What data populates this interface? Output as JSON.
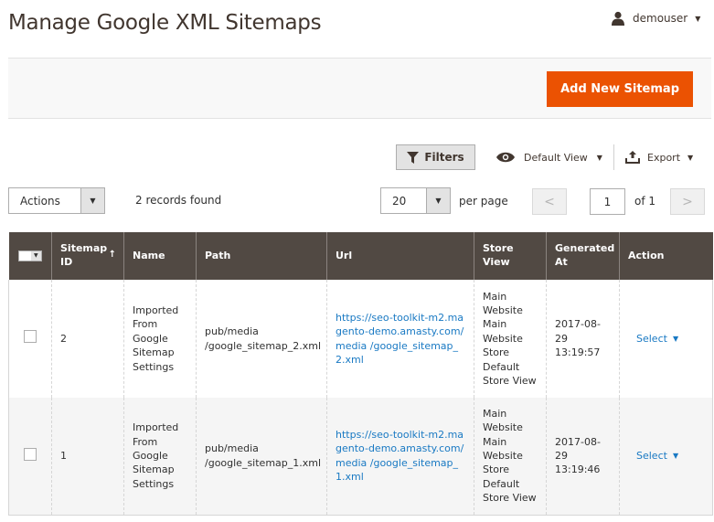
{
  "header": {
    "title": "Manage Google XML Sitemaps",
    "user": {
      "name": "demouser",
      "icon": "user-icon"
    }
  },
  "action_bar": {
    "add_button_label": "Add New Sitemap",
    "accent_color": "#eb5202"
  },
  "toolbar": {
    "filters_label": "Filters",
    "view_label": "Default View",
    "export_label": "Export"
  },
  "controls": {
    "actions_label": "Actions",
    "records_found": "2 records found",
    "per_page_value": "20",
    "per_page_label": "per page",
    "prev_label": "<",
    "next_label": ">",
    "current_page": "1",
    "total_pages_label": "of 1"
  },
  "grid": {
    "columns": [
      {
        "key": "select",
        "label": ""
      },
      {
        "key": "id",
        "label": "Sitemap ID",
        "sorted": "ascending"
      },
      {
        "key": "name",
        "label": "Name"
      },
      {
        "key": "path",
        "label": "Path"
      },
      {
        "key": "url",
        "label": "Url"
      },
      {
        "key": "store_view",
        "label": "Store View"
      },
      {
        "key": "generated_at",
        "label": "Generated At"
      },
      {
        "key": "action",
        "label": "Action"
      }
    ],
    "sort_indicator": "↑",
    "rows": [
      {
        "id": "2",
        "name": "Imported From Google Sitemap Settings",
        "path": "pub/media /google_sitemap_2.xml",
        "url": "https://seo-toolkit-m2.magento-demo.amasty.com/media /google_sitemap_2.xml",
        "store_view": "Main Website\n  Main Website Store\n      Default Store View",
        "generated_at": "2017-08-29 13:19:57",
        "action_label": "Select"
      },
      {
        "id": "1",
        "name": "Imported From Google Sitemap Settings",
        "path": "pub/media /google_sitemap_1.xml",
        "url": "https://seo-toolkit-m2.magento-demo.amasty.com/media /google_sitemap_1.xml",
        "store_view": "Main Website\n  Main Website Store\n      Default Store View",
        "generated_at": "2017-08-29 13:19:46",
        "action_label": "Select"
      }
    ]
  }
}
